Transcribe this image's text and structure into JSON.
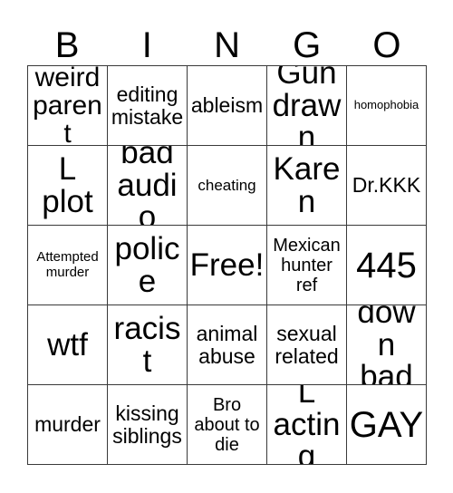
{
  "card": {
    "header": {
      "letters": [
        "B",
        "I",
        "N",
        "G",
        "O"
      ]
    },
    "grid": {
      "rows": 5,
      "columns": 5,
      "border_color": "#3a3a3a",
      "background_color": "#ffffff",
      "text_color": "#000000",
      "cells": [
        {
          "text": "weird parent",
          "size": "xl",
          "free": false
        },
        {
          "text": "editing mistake",
          "size": "ml",
          "free": false
        },
        {
          "text": "ableism",
          "size": "ml",
          "free": false
        },
        {
          "text": "Gun drawn",
          "size": "xxl",
          "free": false
        },
        {
          "text": "homophobia",
          "size": "xs",
          "free": false
        },
        {
          "text": "L plot",
          "size": "xxl",
          "free": false
        },
        {
          "text": "bad audio",
          "size": "xxl",
          "free": false
        },
        {
          "text": "cheating",
          "size": "sm",
          "free": false
        },
        {
          "text": "Karen",
          "size": "xxl",
          "free": false
        },
        {
          "text": "Dr.KKK",
          "size": "ml",
          "free": false
        },
        {
          "text": "Attempted murder",
          "size": "s",
          "free": false
        },
        {
          "text": "police",
          "size": "xxl",
          "free": false
        },
        {
          "text": "Free!",
          "size": "xxl",
          "free": true
        },
        {
          "text": "Mexican hunter ref",
          "size": "m",
          "free": false
        },
        {
          "text": "445",
          "size": "huge",
          "free": false
        },
        {
          "text": "wtf",
          "size": "xxl",
          "free": false
        },
        {
          "text": "racist",
          "size": "xxl",
          "free": false
        },
        {
          "text": "animal abuse",
          "size": "ml",
          "free": false
        },
        {
          "text": "sexual related",
          "size": "ml",
          "free": false
        },
        {
          "text": "down bad",
          "size": "xxl",
          "free": false
        },
        {
          "text": "murder",
          "size": "ml",
          "free": false
        },
        {
          "text": "kissing siblings",
          "size": "ml",
          "free": false
        },
        {
          "text": "Bro about to die",
          "size": "m",
          "free": false
        },
        {
          "text": "L acting",
          "size": "xxl",
          "free": false
        },
        {
          "text": "GAY",
          "size": "huge",
          "free": false
        }
      ]
    }
  }
}
